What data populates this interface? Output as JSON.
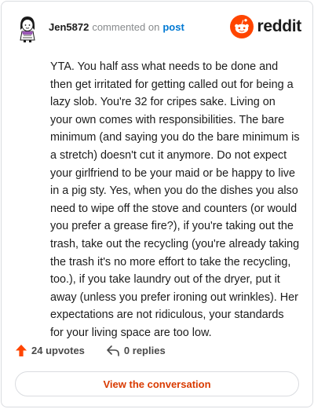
{
  "header": {
    "username": "Jen5872",
    "action_text": "commented on",
    "post_link": "post",
    "brand": "reddit"
  },
  "comment": {
    "body": "YTA. You half ass what needs to be done and then get irritated for getting called out for being a lazy slob. You're 32 for cripes sake. Living on your own comes with responsibilities. The bare minimum (and saying you do the bare minimum is a stretch) doesn't cut it anymore. Do not expect your girlfriend to be your maid or be happy to live in a pig sty. Yes, when you do the dishes you also need to wipe off the stove and counters (or would you prefer a grease fire?), if you're taking out the trash, take out the recycling (you're already taking the trash it's no more effort to take the recycling, too.), if you take laundry out of the dryer, put it away (unless you prefer ironing out wrinkles). Her expectations are not ridiculous, your standards for your living space are too low."
  },
  "actions": {
    "upvotes": "24 upvotes",
    "replies": "0 replies",
    "view_conversation": "View the conversation"
  },
  "icons": {
    "avatar": "avatar-icon",
    "logo": "reddit-logo-icon",
    "upvote": "upvote-arrow-icon",
    "reply": "reply-arrow-icon"
  },
  "colors": {
    "accent": "#ff4500",
    "link": "#0079d3",
    "button_text": "#d93a00",
    "muted": "#878a8c"
  }
}
